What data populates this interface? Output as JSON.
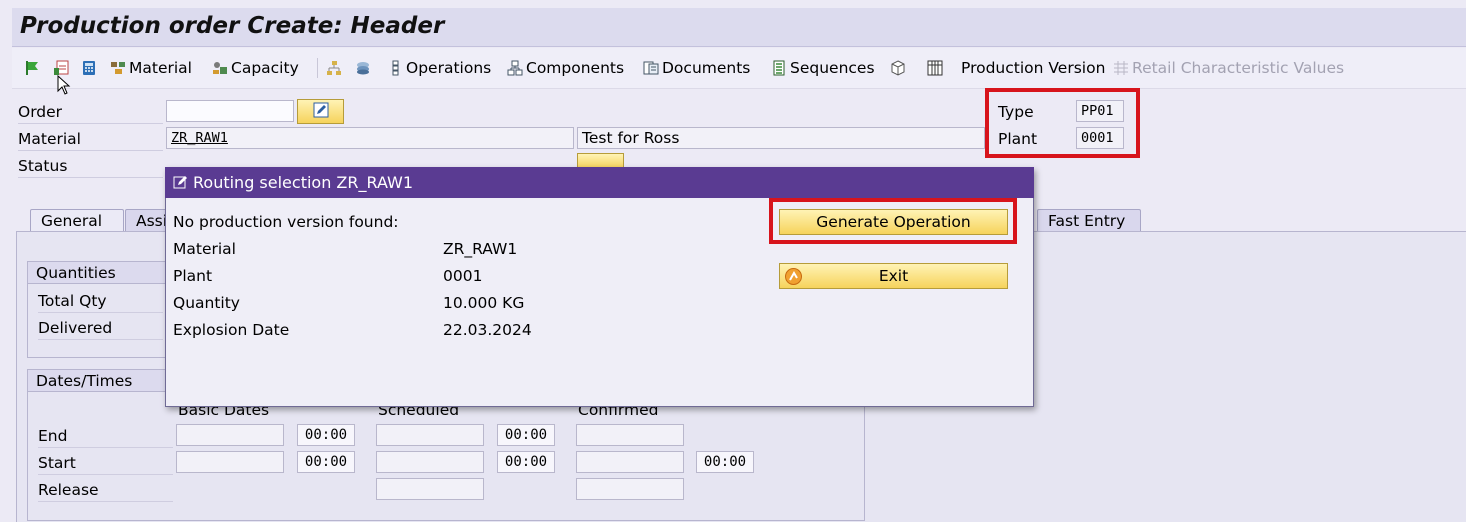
{
  "window": {
    "title": "Production order Create: Header"
  },
  "toolbar": {
    "items": [
      {
        "icon": "flag-icon"
      },
      {
        "icon": "schedule-icon"
      },
      {
        "icon": "calculator-icon"
      },
      {
        "icon": "material-icon",
        "label": "Material"
      },
      {
        "icon": "capacity-icon",
        "label": "Capacity"
      },
      {
        "icon": "hierarchy-icon"
      },
      {
        "icon": "stack-icon"
      },
      {
        "icon": "operations-icon",
        "label": "Operations"
      },
      {
        "icon": "components-icon",
        "label": "Components"
      },
      {
        "icon": "documents-icon",
        "label": "Documents"
      },
      {
        "icon": "sequences-icon",
        "label": "Sequences"
      },
      {
        "icon": "cube-icon"
      },
      {
        "icon": "grid-icon"
      },
      {
        "label": "Production Version"
      },
      {
        "icon": "table-icon",
        "label": "Retail Characteristic Values"
      }
    ]
  },
  "header": {
    "order_label": "Order",
    "order_value": "",
    "material_label": "Material",
    "material_value": "ZR_RAW1",
    "material_desc": "Test for Ross",
    "status_label": "Status",
    "type_label": "Type",
    "type_value": "PP01",
    "plant_label": "Plant",
    "plant_value": "0001"
  },
  "tabs": [
    {
      "label": "General"
    },
    {
      "label": "Assi"
    },
    {
      "label": "Fast Entry"
    }
  ],
  "quantities": {
    "title": "Quantities",
    "total_label": "Total Qty",
    "delivered_label": "Delivered"
  },
  "dates": {
    "title": "Dates/Times",
    "col_basic": "Basic Dates",
    "col_scheduled": "Scheduled",
    "col_confirmed": "Confirmed",
    "end_label": "End",
    "start_label": "Start",
    "release_label": "Release",
    "time_value": "00:00"
  },
  "dialog": {
    "title": "Routing selection ZR_RAW1",
    "message": "No production version found:",
    "rows": [
      {
        "label": "Material",
        "value": "ZR_RAW1"
      },
      {
        "label": "Plant",
        "value": "0001"
      },
      {
        "label": "Quantity",
        "value": "10.000 KG"
      },
      {
        "label": "Explosion Date",
        "value": "22.03.2024"
      }
    ],
    "generate_button": "Generate Operation",
    "exit_button": "Exit"
  },
  "colors": {
    "dialog_header": "#5a3b92",
    "highlight_box": "#d7141c",
    "button": "#f6d35c"
  }
}
